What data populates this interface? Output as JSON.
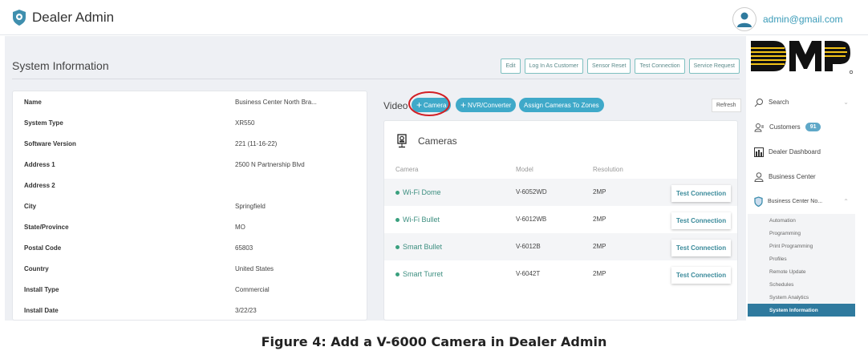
{
  "header": {
    "app_name": "Dealer Admin",
    "user_email": "admin@gmail.com"
  },
  "brand": {
    "logo_text": "DMP"
  },
  "page": {
    "title": "System Information",
    "actions": [
      "Edit",
      "Log In As Customer",
      "Sensor Reset",
      "Test Connection",
      "Service Request"
    ]
  },
  "system_info": [
    {
      "label": "Name",
      "value": "Business Center North Bra..."
    },
    {
      "label": "System Type",
      "value": "XR550"
    },
    {
      "label": "Software Version",
      "value": "221 (11-16-22)"
    },
    {
      "label": "Address 1",
      "value": "2500 N Partnership Blvd"
    },
    {
      "label": "Address 2",
      "value": ""
    },
    {
      "label": "City",
      "value": "Springfield"
    },
    {
      "label": "State/Province",
      "value": "MO"
    },
    {
      "label": "Postal Code",
      "value": "65803"
    },
    {
      "label": "Country",
      "value": "United States"
    },
    {
      "label": "Install Type",
      "value": "Commercial"
    },
    {
      "label": "Install Date",
      "value": "3/22/23"
    }
  ],
  "video": {
    "label": "Video",
    "add_camera": "Camera",
    "add_nvr": "NVR/Converter",
    "assign": "Assign Cameras To Zones",
    "refresh": "Refresh"
  },
  "cameras": {
    "title": "Cameras",
    "columns": [
      "Camera",
      "Model",
      "Resolution"
    ],
    "test_label": "Test Connection",
    "rows": [
      {
        "name": "Wi-Fi Dome",
        "model": "V-6052WD",
        "resolution": "2MP"
      },
      {
        "name": "Wi-Fi Bullet",
        "model": "V-6012WB",
        "resolution": "2MP"
      },
      {
        "name": "Smart Bullet",
        "model": "V-6012B",
        "resolution": "2MP"
      },
      {
        "name": "Smart Turret",
        "model": "V-6042T",
        "resolution": "2MP"
      }
    ]
  },
  "sidebar": {
    "search": "Search",
    "customers": "Customers",
    "customers_count": "91",
    "dashboard": "Dealer Dashboard",
    "business_center": "Business Center",
    "current_system": "Business Center No...",
    "sub_items": [
      "Automation",
      "Programming",
      "Print Programming",
      "Profiles",
      "Remote Update",
      "Schedules",
      "System Analytics",
      "System Information"
    ]
  },
  "caption": "Figure 4:  Add a V-6000 Camera in Dealer Admin",
  "colors": {
    "accent": "#3fa9c9",
    "active": "#2f7a9e",
    "highlight": "#d21f25"
  }
}
